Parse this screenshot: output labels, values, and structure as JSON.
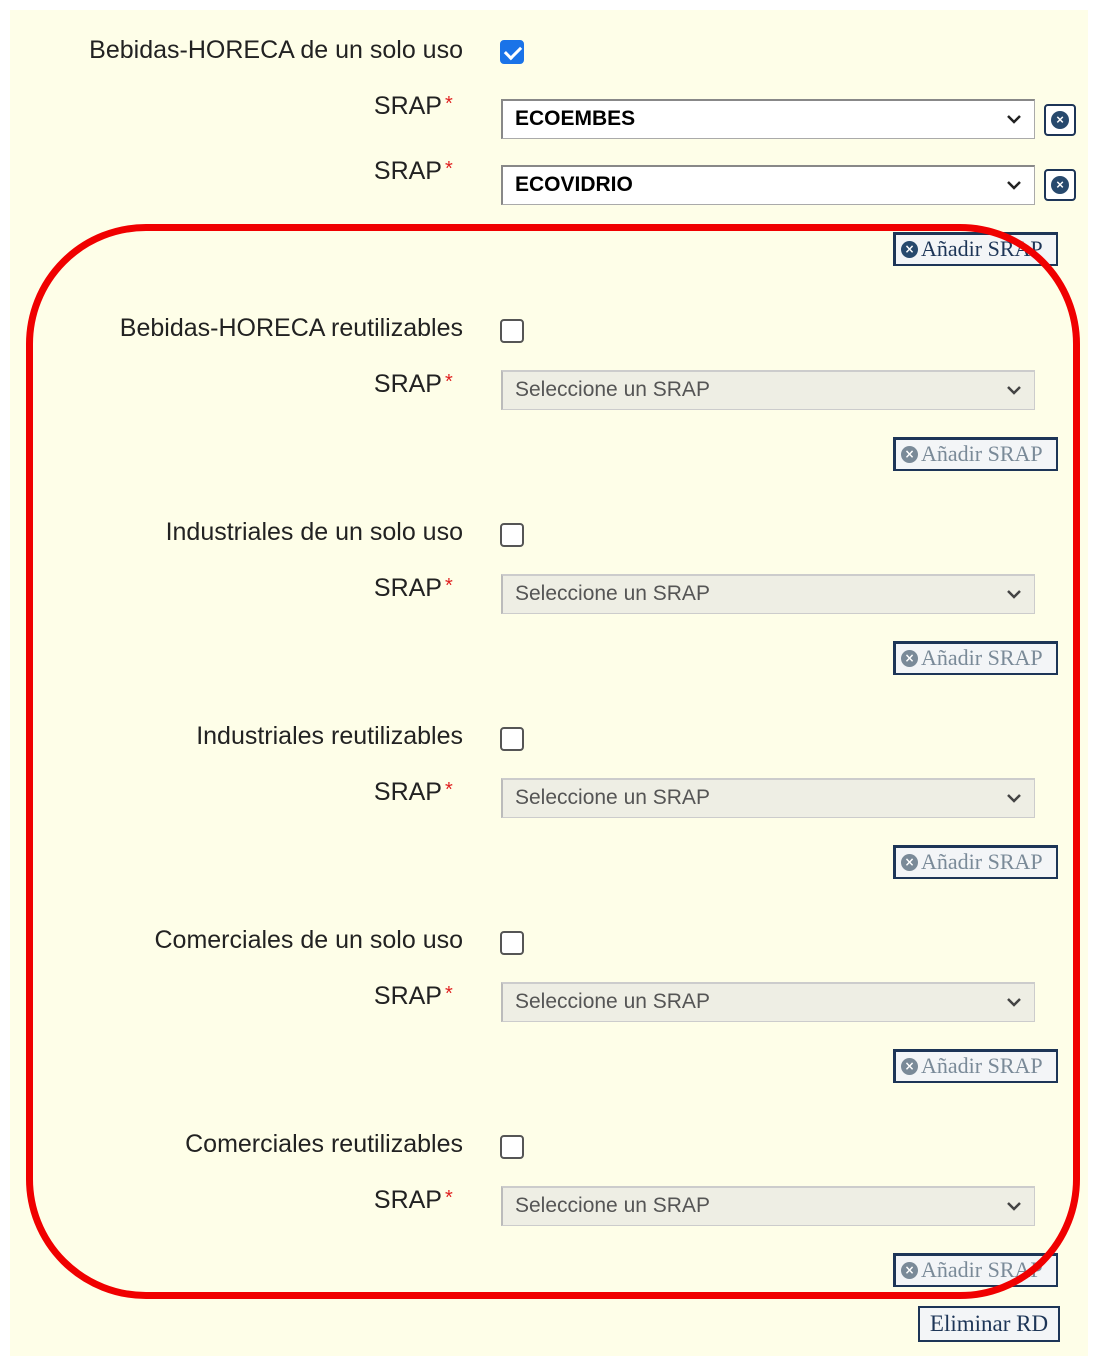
{
  "groups": [
    {
      "label": "Bebidas-HORECA de un solo uso",
      "checked": true,
      "selects": [
        "ECOEMBES",
        "ECOVIDRIO"
      ],
      "add_label": "Añadir SRAP"
    },
    {
      "label": "Bebidas-HORECA reutilizables",
      "checked": false,
      "selects": [
        "Seleccione un SRAP"
      ],
      "add_label": "Añadir SRAP"
    },
    {
      "label": "Industriales de un solo uso",
      "checked": false,
      "selects": [
        "Seleccione un SRAP"
      ],
      "add_label": "Añadir SRAP"
    },
    {
      "label": "Industriales reutilizables",
      "checked": false,
      "selects": [
        "Seleccione un SRAP"
      ],
      "add_label": "Añadir SRAP"
    },
    {
      "label": "Comerciales de un solo uso",
      "checked": false,
      "selects": [
        "Seleccione un SRAP"
      ],
      "add_label": "Añadir SRAP"
    },
    {
      "label": "Comerciales reutilizables",
      "checked": false,
      "selects": [
        "Seleccione un SRAP"
      ],
      "add_label": "Añadir SRAP"
    }
  ],
  "srap_label": "SRAP",
  "required_marker": "*",
  "delete_label": "Eliminar RD",
  "colors": {
    "highlight": "#f00000",
    "background": "#fefee8",
    "checkbox_checked": "#1a73e8"
  },
  "icons": {
    "remove": "circle-x-icon",
    "add": "circle-x-icon",
    "dropdown": "chevron-down-icon"
  }
}
